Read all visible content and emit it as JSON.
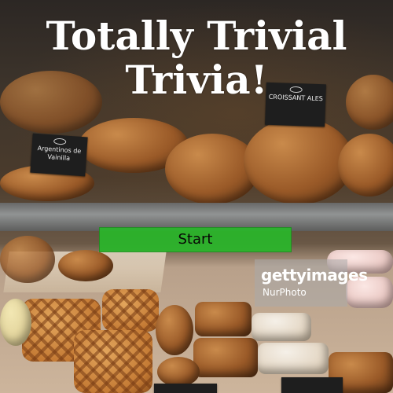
{
  "title": "Totally Trivial Trivia!",
  "start_button": {
    "label": "Start",
    "color": "#29b72a"
  },
  "background": {
    "description_icon": "bakery-display-photo",
    "signs": {
      "left": "Argentinos de Vainilla",
      "right": "CROISSANT ALES"
    }
  },
  "watermark": {
    "brand": "gettyimages",
    "credit": "NurPhoto"
  }
}
